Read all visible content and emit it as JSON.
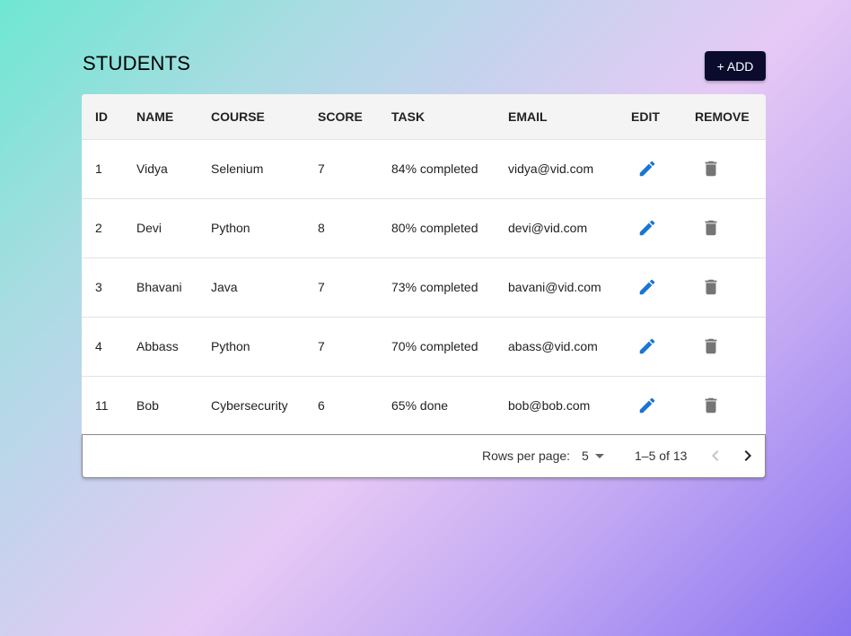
{
  "page": {
    "title": "STUDENTS",
    "add_label": "+ ADD"
  },
  "table": {
    "headers": {
      "id": "ID",
      "name": "NAME",
      "course": "COURSE",
      "score": "SCORE",
      "task": "TASK",
      "email": "EMAIL",
      "edit": "EDIT",
      "remove": "REMOVE"
    },
    "rows": [
      {
        "id": "1",
        "name": "Vidya",
        "course": "Selenium",
        "score": "7",
        "task": "84% completed",
        "email": "vidya@vid.com"
      },
      {
        "id": "2",
        "name": "Devi",
        "course": "Python",
        "score": "8",
        "task": "80% completed",
        "email": "devi@vid.com"
      },
      {
        "id": "3",
        "name": "Bhavani",
        "course": "Java",
        "score": "7",
        "task": "73% completed",
        "email": "bavani@vid.com"
      },
      {
        "id": "4",
        "name": "Abbass",
        "course": "Python",
        "score": "7",
        "task": "70% completed",
        "email": "abass@vid.com"
      },
      {
        "id": "11",
        "name": "Bob",
        "course": "Cybersecurity",
        "score": "6",
        "task": "65% done",
        "email": "bob@bob.com"
      }
    ],
    "edit_icon": "pencil-icon",
    "remove_icon": "trash-icon"
  },
  "pagination": {
    "rows_per_page_label": "Rows per page:",
    "rows_per_page_value": "5",
    "range_text": "1–5 of 13",
    "prev_icon": "chevron-left-icon",
    "next_icon": "chevron-right-icon"
  },
  "colors": {
    "accent": "#1976d2",
    "add_button": "#0b0b2e",
    "delete_icon": "#757575"
  }
}
